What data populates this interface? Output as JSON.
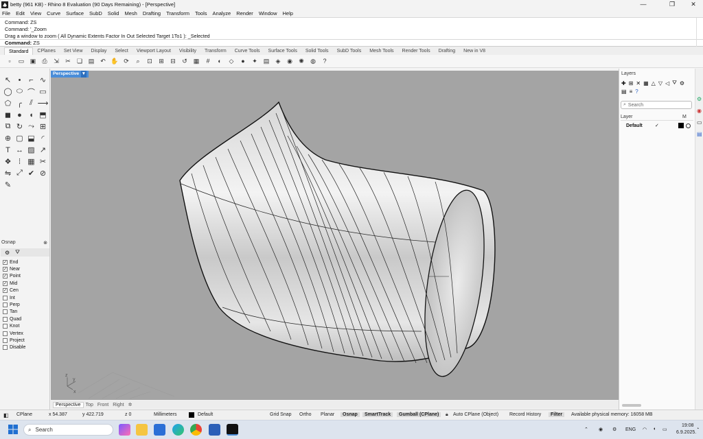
{
  "window": {
    "title": "betty (961 KB) - Rhino 8 Evaluation (90 Days Remaining) - [Perspective]",
    "controls": [
      "—",
      "❐",
      "✕"
    ]
  },
  "menu": [
    "File",
    "Edit",
    "View",
    "Curve",
    "Surface",
    "SubD",
    "Solid",
    "Mesh",
    "Drafting",
    "Transform",
    "Tools",
    "Analyze",
    "Render",
    "Window",
    "Help"
  ],
  "command_history": [
    "Command: ZS",
    "Command: '_Zoom",
    "Drag a window to zoom ( All  Dynamic  Extents  Factor  In  Out  Selected  Target  1To1 ): _Selected"
  ],
  "command_prompt": {
    "label": "Command:",
    "value": "ZS"
  },
  "toolbar_tabs": [
    "Standard",
    "CPlanes",
    "Set View",
    "Display",
    "Select",
    "Viewport Layout",
    "Visibility",
    "Transform",
    "Curve Tools",
    "Surface Tools",
    "Solid Tools",
    "SubD Tools",
    "Mesh Tools",
    "Render Tools",
    "Drafting",
    "New in V8"
  ],
  "active_toolbar_tab": "Standard",
  "toolbar_icons": [
    "new-icon",
    "open-icon",
    "save-icon",
    "print-icon",
    "import-icon",
    "cut-icon",
    "copy-icon",
    "paste-icon",
    "undo-icon",
    "pan-icon",
    "rotate-view-icon",
    "zoom-icon",
    "zoom-window-icon",
    "zoom-extents-icon",
    "zoom-selected-icon",
    "undo-view-icon",
    "four-viewports-icon",
    "grid-icon",
    "display-mode-icon",
    "wireframe-icon",
    "shaded-icon",
    "lights-icon",
    "layers-icon",
    "object-properties-icon",
    "materials-icon",
    "render-icon",
    "environment-icon",
    "help-icon"
  ],
  "osnap": {
    "title": "Osnap",
    "close": "⊗",
    "items": [
      {
        "label": "End",
        "checked": true
      },
      {
        "label": "Near",
        "checked": true
      },
      {
        "label": "Point",
        "checked": true
      },
      {
        "label": "Mid",
        "checked": true
      },
      {
        "label": "Cen",
        "checked": true
      },
      {
        "label": "Int",
        "checked": false
      },
      {
        "label": "Perp",
        "checked": false
      },
      {
        "label": "Tan",
        "checked": false
      },
      {
        "label": "Quad",
        "checked": false
      },
      {
        "label": "Knot",
        "checked": false
      },
      {
        "label": "Vertex",
        "checked": false
      },
      {
        "label": "Project",
        "checked": false
      },
      {
        "label": "Disable",
        "checked": false
      }
    ]
  },
  "viewport": {
    "label": "Perspective",
    "caret": "▾",
    "background": "#a4a4a4",
    "axis_labels": [
      "z",
      "y",
      "x"
    ]
  },
  "viewport_tabs": [
    "Perspective",
    "Top",
    "Front",
    "Right"
  ],
  "viewport_tab_add": "✲",
  "layers_panel": {
    "title": "Layers",
    "search_placeholder": "Search",
    "columns": [
      "Layer",
      "M"
    ],
    "rows": [
      {
        "name": "Default",
        "current": "✓",
        "color": "#000000"
      }
    ]
  },
  "status": {
    "cplane": "CPlane",
    "x": "x 54.387",
    "y": "y 422.719",
    "z": "z 0",
    "units": "Millimeters",
    "layer": "Default",
    "grid_snap": "Grid Snap",
    "ortho": "Ortho",
    "planar": "Planar",
    "osnap": "Osnap",
    "smarttrack": "SmartTrack",
    "gumball": "Gumball (CPlane)",
    "auto_cplane": "Auto CPlane (Object)",
    "record_history": "Record History",
    "filter": "Filter",
    "memory": "Available physical memory: 16058 MB"
  },
  "taskbar": {
    "search_placeholder": "Search",
    "language": "ENG",
    "time": "19:08",
    "date": "6.9.2025."
  }
}
